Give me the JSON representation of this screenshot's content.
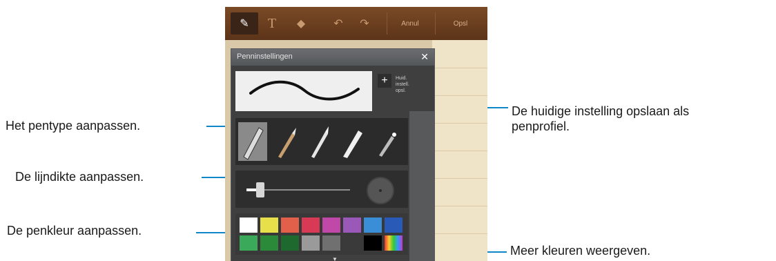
{
  "toolbar": {
    "tools": [
      {
        "name": "pen-tool-icon",
        "glyph": "✎"
      },
      {
        "name": "text-tool-icon",
        "glyph": "T"
      },
      {
        "name": "eraser-tool-icon",
        "glyph": "◆"
      },
      {
        "name": "undo-icon",
        "glyph": "↶"
      },
      {
        "name": "redo-icon",
        "glyph": "↷"
      }
    ],
    "cancel_label": "Annul",
    "save_label": "Opsl"
  },
  "panel": {
    "title": "Penninstellingen",
    "close_glyph": "✕",
    "add_glyph": "+",
    "save_profile_label": "Huid. instell. opsl."
  },
  "callouts": {
    "pen_type": "Het pentype aanpassen.",
    "line_thickness": "De lijndikte aanpassen.",
    "pen_color": "De penkleur aanpassen.",
    "save_profile_line1": "De huidige instelling opslaan als",
    "save_profile_line2": "penprofiel.",
    "more_colors": "Meer kleuren weergeven."
  },
  "thickness": {
    "level": 0.12
  },
  "colors": {
    "row1": [
      "#ffffff",
      "#e8e04a",
      "#e2604a",
      "#d83a55",
      "#c048a8",
      "#9a58b8",
      "#3a8ed8",
      "#2a5ab8"
    ],
    "row2": [
      "#3aaa5a",
      "#2a8a3a",
      "#1e6a2e",
      "#9a9a9a",
      "#707070",
      "#3a3a3a",
      "#000000",
      "rainbow"
    ],
    "accent": "#0e86c8",
    "toolbar": "#6a3e20"
  }
}
